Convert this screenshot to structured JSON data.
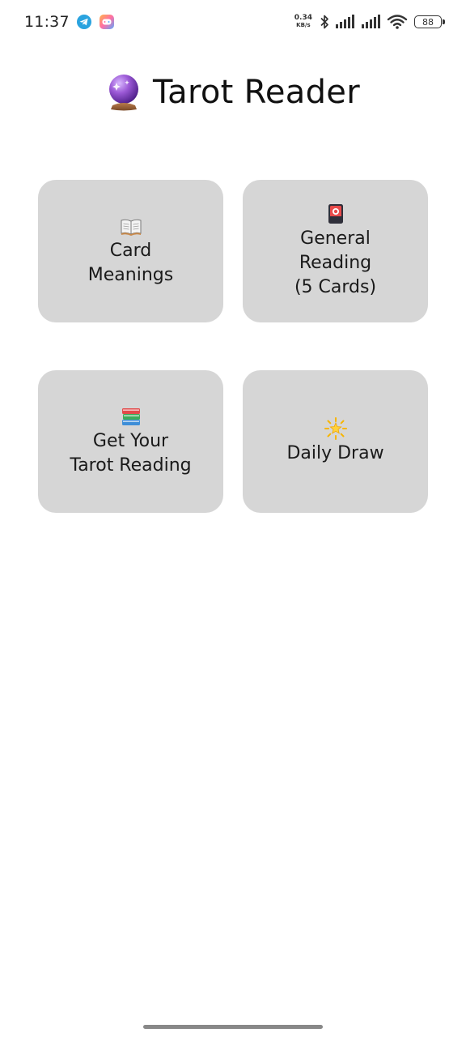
{
  "status_bar": {
    "time": "11:37",
    "net_speed_value": "0.34",
    "net_speed_unit": "KB/s",
    "battery_level": "88",
    "icons": [
      "telegram-icon",
      "game-app-icon",
      "bluetooth-icon",
      "signal-icon",
      "signal-icon",
      "wifi-icon",
      "battery-icon"
    ]
  },
  "header": {
    "title": "Tarot Reader",
    "icon": "crystal-ball-icon"
  },
  "menu": {
    "tiles": [
      {
        "icon": "open-book-icon",
        "label": "Card\nMeanings"
      },
      {
        "icon": "flower-playing-card-icon",
        "label": "General\nReading\n(5 Cards)"
      },
      {
        "icon": "books-icon",
        "label": "Get Your\nTarot Reading"
      },
      {
        "icon": "glowing-star-icon",
        "label": "Daily Draw"
      }
    ]
  },
  "colors": {
    "tile_background": "#d6d6d6",
    "page_background": "#ffffff",
    "telegram_blue": "#2aa3df"
  }
}
